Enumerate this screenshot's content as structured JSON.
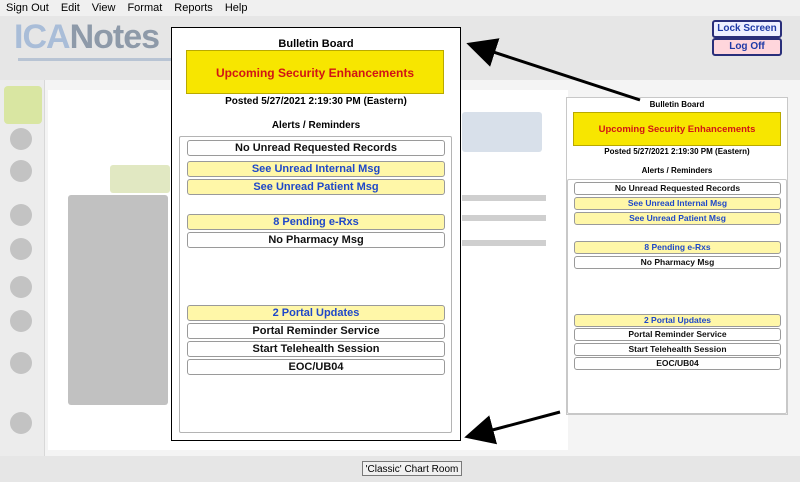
{
  "menu": [
    "Sign Out",
    "Edit",
    "View",
    "Format",
    "Reports",
    "Help"
  ],
  "header": {
    "logo": "ICANotes",
    "lock_screen": "Lock Screen",
    "log_off": "Log Off"
  },
  "bulletin": {
    "title": "Bulletin Board",
    "banner": "Upcoming Security Enhancements",
    "posted": "Posted 5/27/2021 2:19:30 PM (Eastern)",
    "alerts_title": "Alerts / Reminders",
    "items": [
      {
        "label": "No Unread Requested Records",
        "style": "white"
      },
      {
        "label": "See Unread Internal Msg",
        "style": "yellow"
      },
      {
        "label": "See Unread Patient Msg",
        "style": "yellow"
      },
      {
        "label": "8 Pending e-Rxs",
        "style": "yellow"
      },
      {
        "label": "No Pharmacy Msg",
        "style": "white"
      },
      {
        "label": "2 Portal Updates",
        "style": "yellow"
      },
      {
        "label": "Portal Reminder Service",
        "style": "white"
      },
      {
        "label": "Start Telehealth Session",
        "style": "white"
      },
      {
        "label": "EOC/UB04",
        "style": "white"
      }
    ]
  },
  "footer": {
    "classic_chart_room": "'Classic' Chart Room"
  },
  "colors": {
    "banner_bg": "#f7e600",
    "banner_text": "#d11515",
    "link_blue": "#1f48c9",
    "highlight_yellow": "#fff7a8"
  }
}
